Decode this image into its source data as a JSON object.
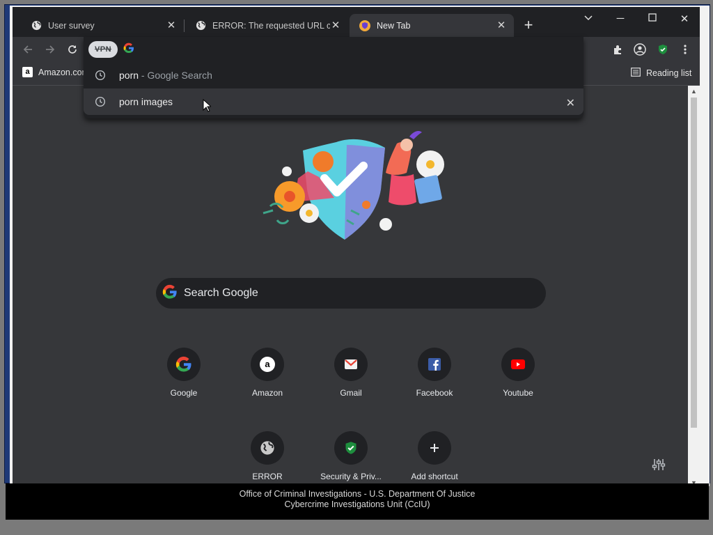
{
  "tabs": [
    {
      "title": "User survey",
      "favicon": "globe-icon",
      "active": false
    },
    {
      "title": "ERROR: The requested URL could not be retrieved",
      "favicon": "globe-icon",
      "active": false
    },
    {
      "title": "New Tab",
      "favicon": "vpn-shield-icon",
      "active": true
    }
  ],
  "toolbar": {
    "vpn_label": "VPN"
  },
  "omnibox": {
    "suggestions": [
      {
        "text": "porn",
        "suffix": " - Google Search"
      },
      {
        "text": "porn images",
        "suffix": ""
      }
    ]
  },
  "bookmarks": {
    "amazon_label": "Amazon.com",
    "reading_list": "Reading list"
  },
  "ntp": {
    "search_placeholder": "Search Google",
    "shortcuts": [
      {
        "name": "Google",
        "icon": "google-icon"
      },
      {
        "name": "Amazon",
        "icon": "amazon-icon"
      },
      {
        "name": "Gmail",
        "icon": "gmail-icon"
      },
      {
        "name": "Facebook",
        "icon": "facebook-icon"
      },
      {
        "name": "Youtube",
        "icon": "youtube-icon"
      },
      {
        "name": "ERROR",
        "icon": "globe-icon"
      },
      {
        "name": "Security & Priv...",
        "icon": "shield-check-icon"
      },
      {
        "name": "Add shortcut",
        "icon": "plus-icon"
      }
    ]
  },
  "banner": {
    "line1": "Office of Criminal Investigations - U.S. Department Of Justice",
    "line2": "Cybercrime Investigations Unit (CcIU)"
  },
  "colors": {
    "frame_blue": "#1f3a78",
    "page_bg": "#36373a",
    "tab_bg": "#202124",
    "accent_green": "#1e8e3e"
  }
}
